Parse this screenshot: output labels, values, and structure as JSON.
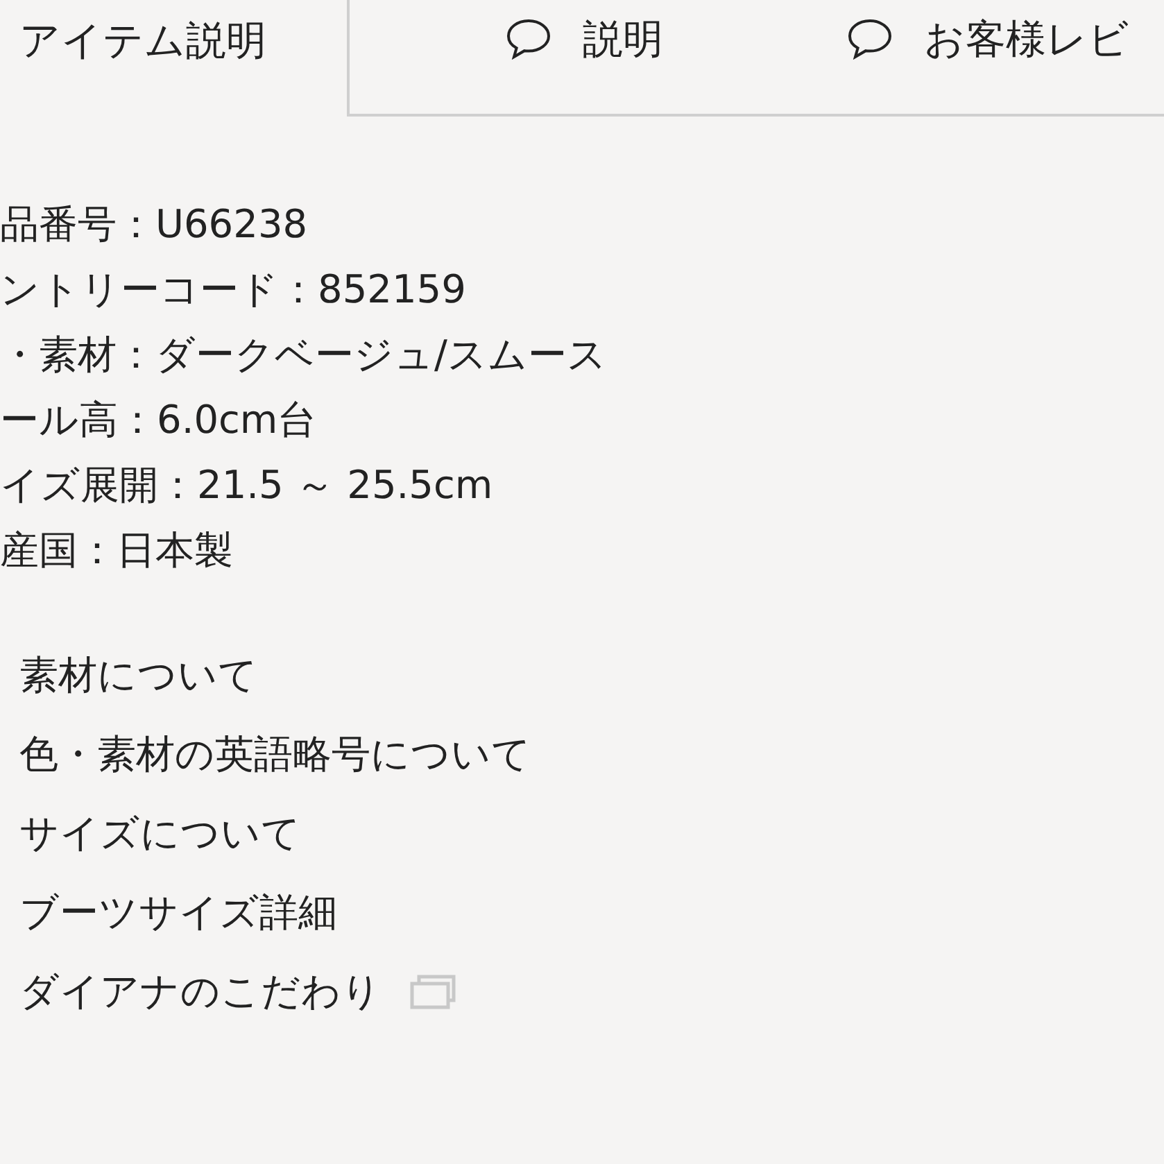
{
  "tabs": [
    {
      "label": "アイテム説明",
      "selected": true,
      "kind": "plain"
    },
    {
      "label": "説明",
      "selected": false,
      "kind": "comment"
    },
    {
      "label": "お客様レビ",
      "selected": false,
      "kind": "comment"
    }
  ],
  "specs": [
    "品番号：U66238",
    "ントリーコード：852159",
    "・素材：ダークベージュ/スムース",
    "ール高：6.0cm台",
    "イズ展開：21.5 ～ 25.5cm",
    "産国：日本製"
  ],
  "links": [
    {
      "label": "素材について",
      "external": false
    },
    {
      "label": "色・素材の英語略号について",
      "external": false
    },
    {
      "label": "サイズについて",
      "external": false
    },
    {
      "label": "ブーツサイズ詳細",
      "external": false
    },
    {
      "label": "ダイアナのこだわり",
      "external": true
    }
  ]
}
